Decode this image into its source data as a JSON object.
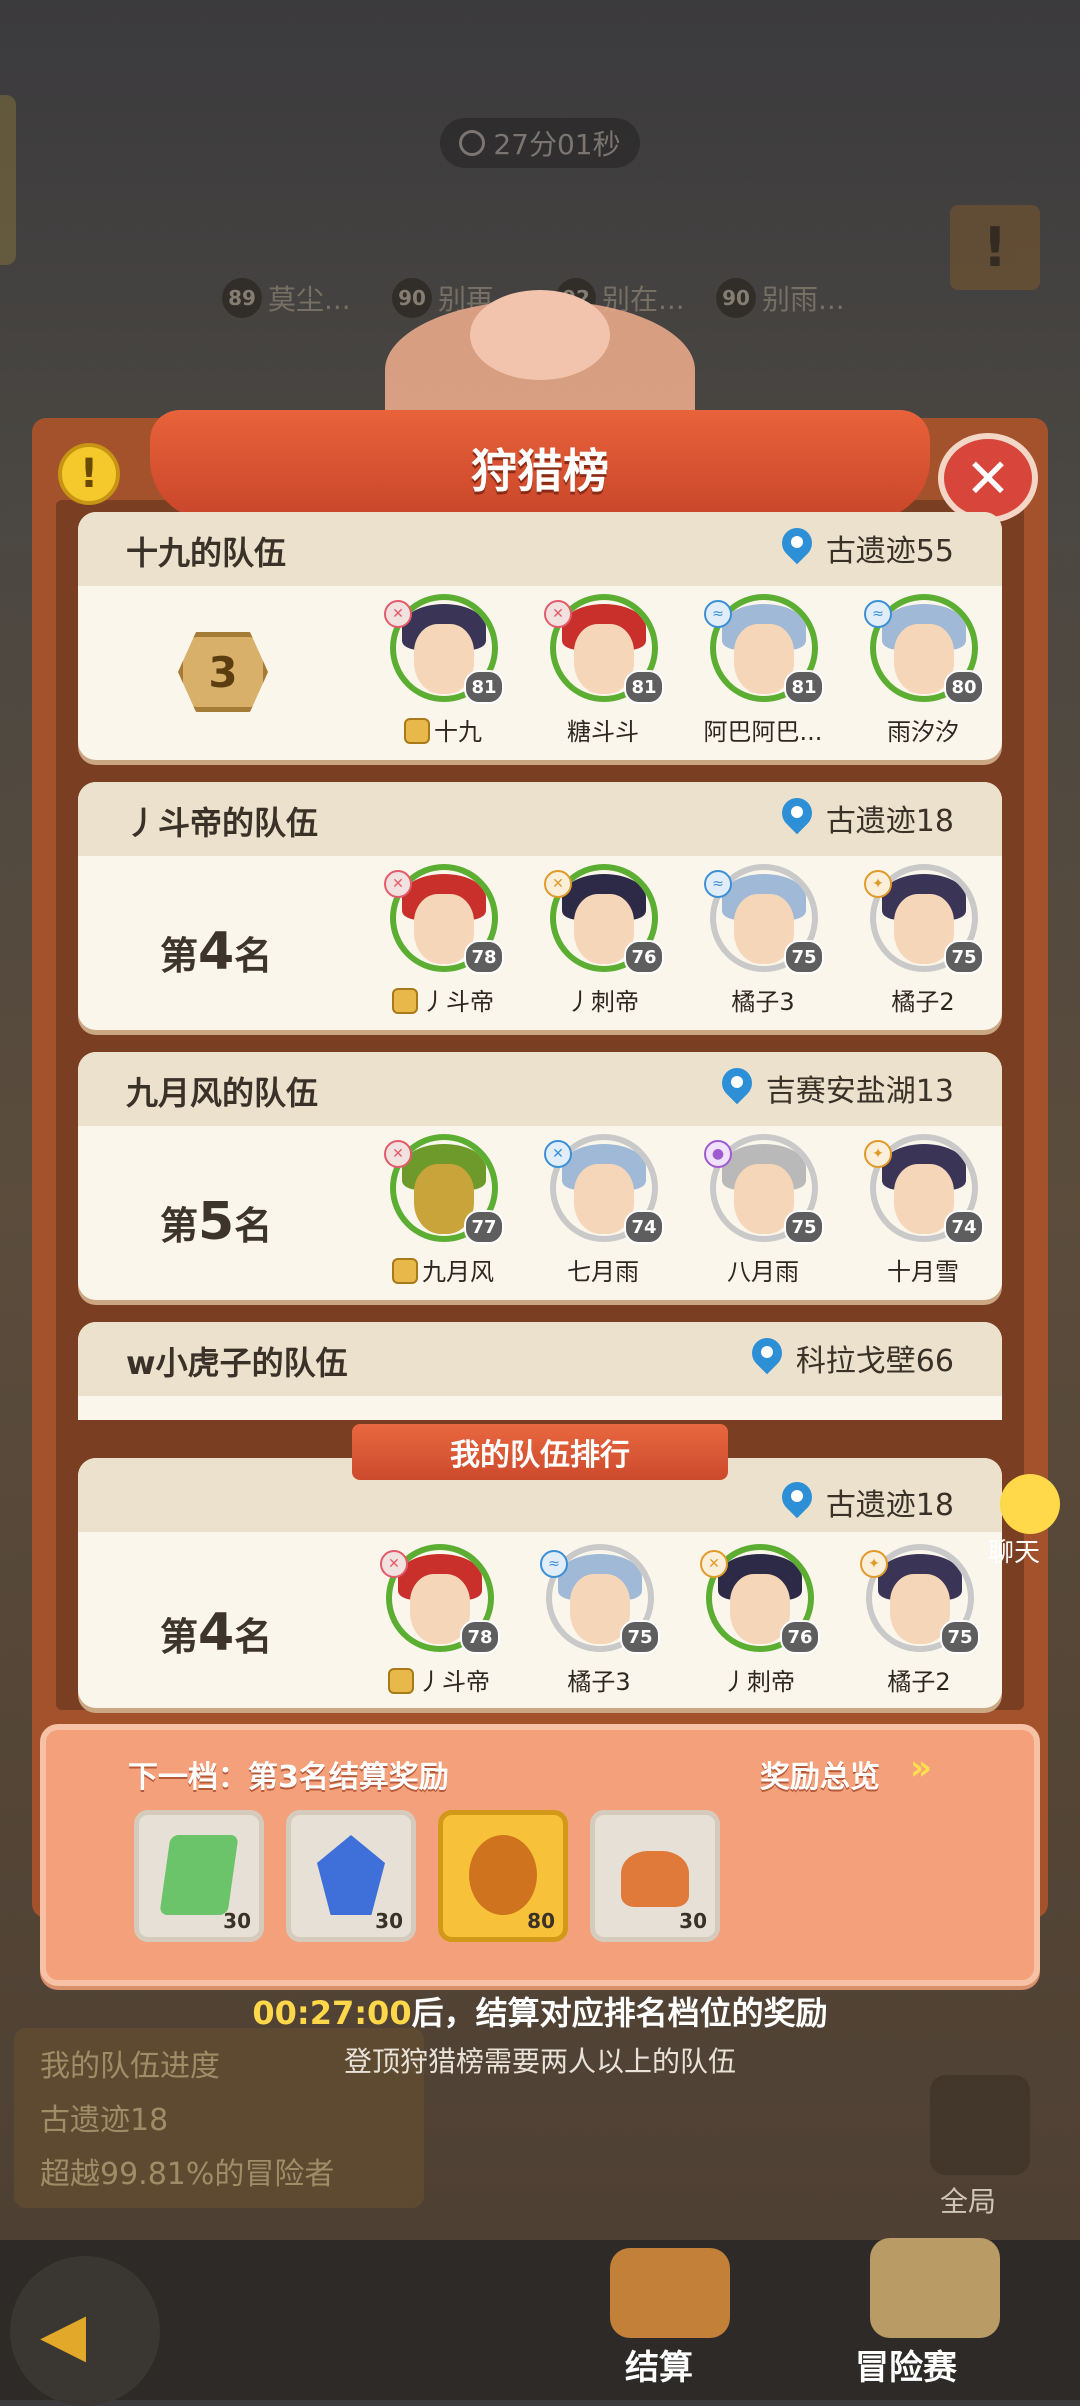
{
  "timer": "27分01秒",
  "top_players": [
    {
      "level": "89",
      "name": "莫尘..."
    },
    {
      "level": "90",
      "name": "别再..."
    },
    {
      "level": "92",
      "name": "别在..."
    },
    {
      "level": "90",
      "name": "别雨..."
    }
  ],
  "title": "狩猎榜",
  "teams": [
    {
      "name": "十九的队伍",
      "location": "古遗迹55",
      "rank_num": "3",
      "members": [
        {
          "name": "十九",
          "level": "81",
          "leader": true,
          "hair": "#3a3456"
        },
        {
          "name": "糖斗斗",
          "level": "81",
          "leader": false,
          "hair": "#c9302c"
        },
        {
          "name": "阿巴阿巴...",
          "level": "81",
          "leader": false,
          "hair": "#9fb9d6"
        },
        {
          "name": "雨汐汐",
          "level": "80",
          "leader": false,
          "hair": "#9fb9d6"
        }
      ]
    },
    {
      "name": "丿斗帝的队伍",
      "location": "古遗迹18",
      "rank_prefix": "第",
      "rank_num": "4",
      "rank_suffix": "名",
      "members": [
        {
          "name": "丿斗帝",
          "level": "78",
          "leader": true,
          "hair": "#c9302c"
        },
        {
          "name": "丿刺帝",
          "level": "76",
          "leader": false,
          "hair": "#2d2a48"
        },
        {
          "name": "橘子3",
          "level": "75",
          "leader": false,
          "hair": "#9fb9d6"
        },
        {
          "name": "橘子2",
          "level": "75",
          "leader": false,
          "hair": "#3a3456"
        }
      ]
    },
    {
      "name": "九月风的队伍",
      "location": "吉赛安盐湖13",
      "rank_prefix": "第",
      "rank_num": "5",
      "rank_suffix": "名",
      "members": [
        {
          "name": "九月风",
          "level": "77",
          "leader": true,
          "hair": "#6d9a2a"
        },
        {
          "name": "七月雨",
          "level": "74",
          "leader": false,
          "hair": "#9fb9d6"
        },
        {
          "name": "八月雨",
          "level": "75",
          "leader": false,
          "hair": "#b9b9b9"
        },
        {
          "name": "十月雪",
          "level": "74",
          "leader": false,
          "hair": "#3a3456"
        }
      ]
    },
    {
      "name": "w小虎子的队伍",
      "location": "科拉戈壁66",
      "members": []
    }
  ],
  "my_team": {
    "banner": "我的队伍排行",
    "location": "古遗迹18",
    "rank_prefix": "第",
    "rank_num": "4",
    "rank_suffix": "名",
    "members": [
      {
        "name": "丿斗帝",
        "level": "78",
        "leader": true,
        "hair": "#c9302c"
      },
      {
        "name": "橘子3",
        "level": "75",
        "leader": false,
        "hair": "#9fb9d6"
      },
      {
        "name": "丿刺帝",
        "level": "76",
        "leader": false,
        "hair": "#2d2a48"
      },
      {
        "name": "橘子2",
        "level": "75",
        "leader": false,
        "hair": "#3a3456"
      }
    ]
  },
  "rewards": {
    "next_tier": "下一档：第3名结算奖励",
    "overview": "奖励总览",
    "items": [
      {
        "qty": "30",
        "icon": "green-ticket-icon",
        "color": "#6cc46a"
      },
      {
        "qty": "30",
        "icon": "blue-crystal-icon",
        "color": "#3f6fd8"
      },
      {
        "qty": "80",
        "icon": "gold-orb-icon",
        "color": "#d0731e"
      },
      {
        "qty": "30",
        "icon": "food-dish-icon",
        "color": "#e07a3a"
      }
    ]
  },
  "countdown_time": "00:27:00",
  "countdown_text": "后，结算对应排名档位的奖励",
  "note": "登顶狩猎榜需要两人以上的队伍",
  "progress": {
    "title": "我的队伍进度",
    "location": "古遗迹18",
    "line3": "超越99.81%的冒险者"
  },
  "chat_label": "聊天",
  "global_label": "全局",
  "bottom_nav": {
    "settle": "结算",
    "adventure": "冒险赛"
  }
}
